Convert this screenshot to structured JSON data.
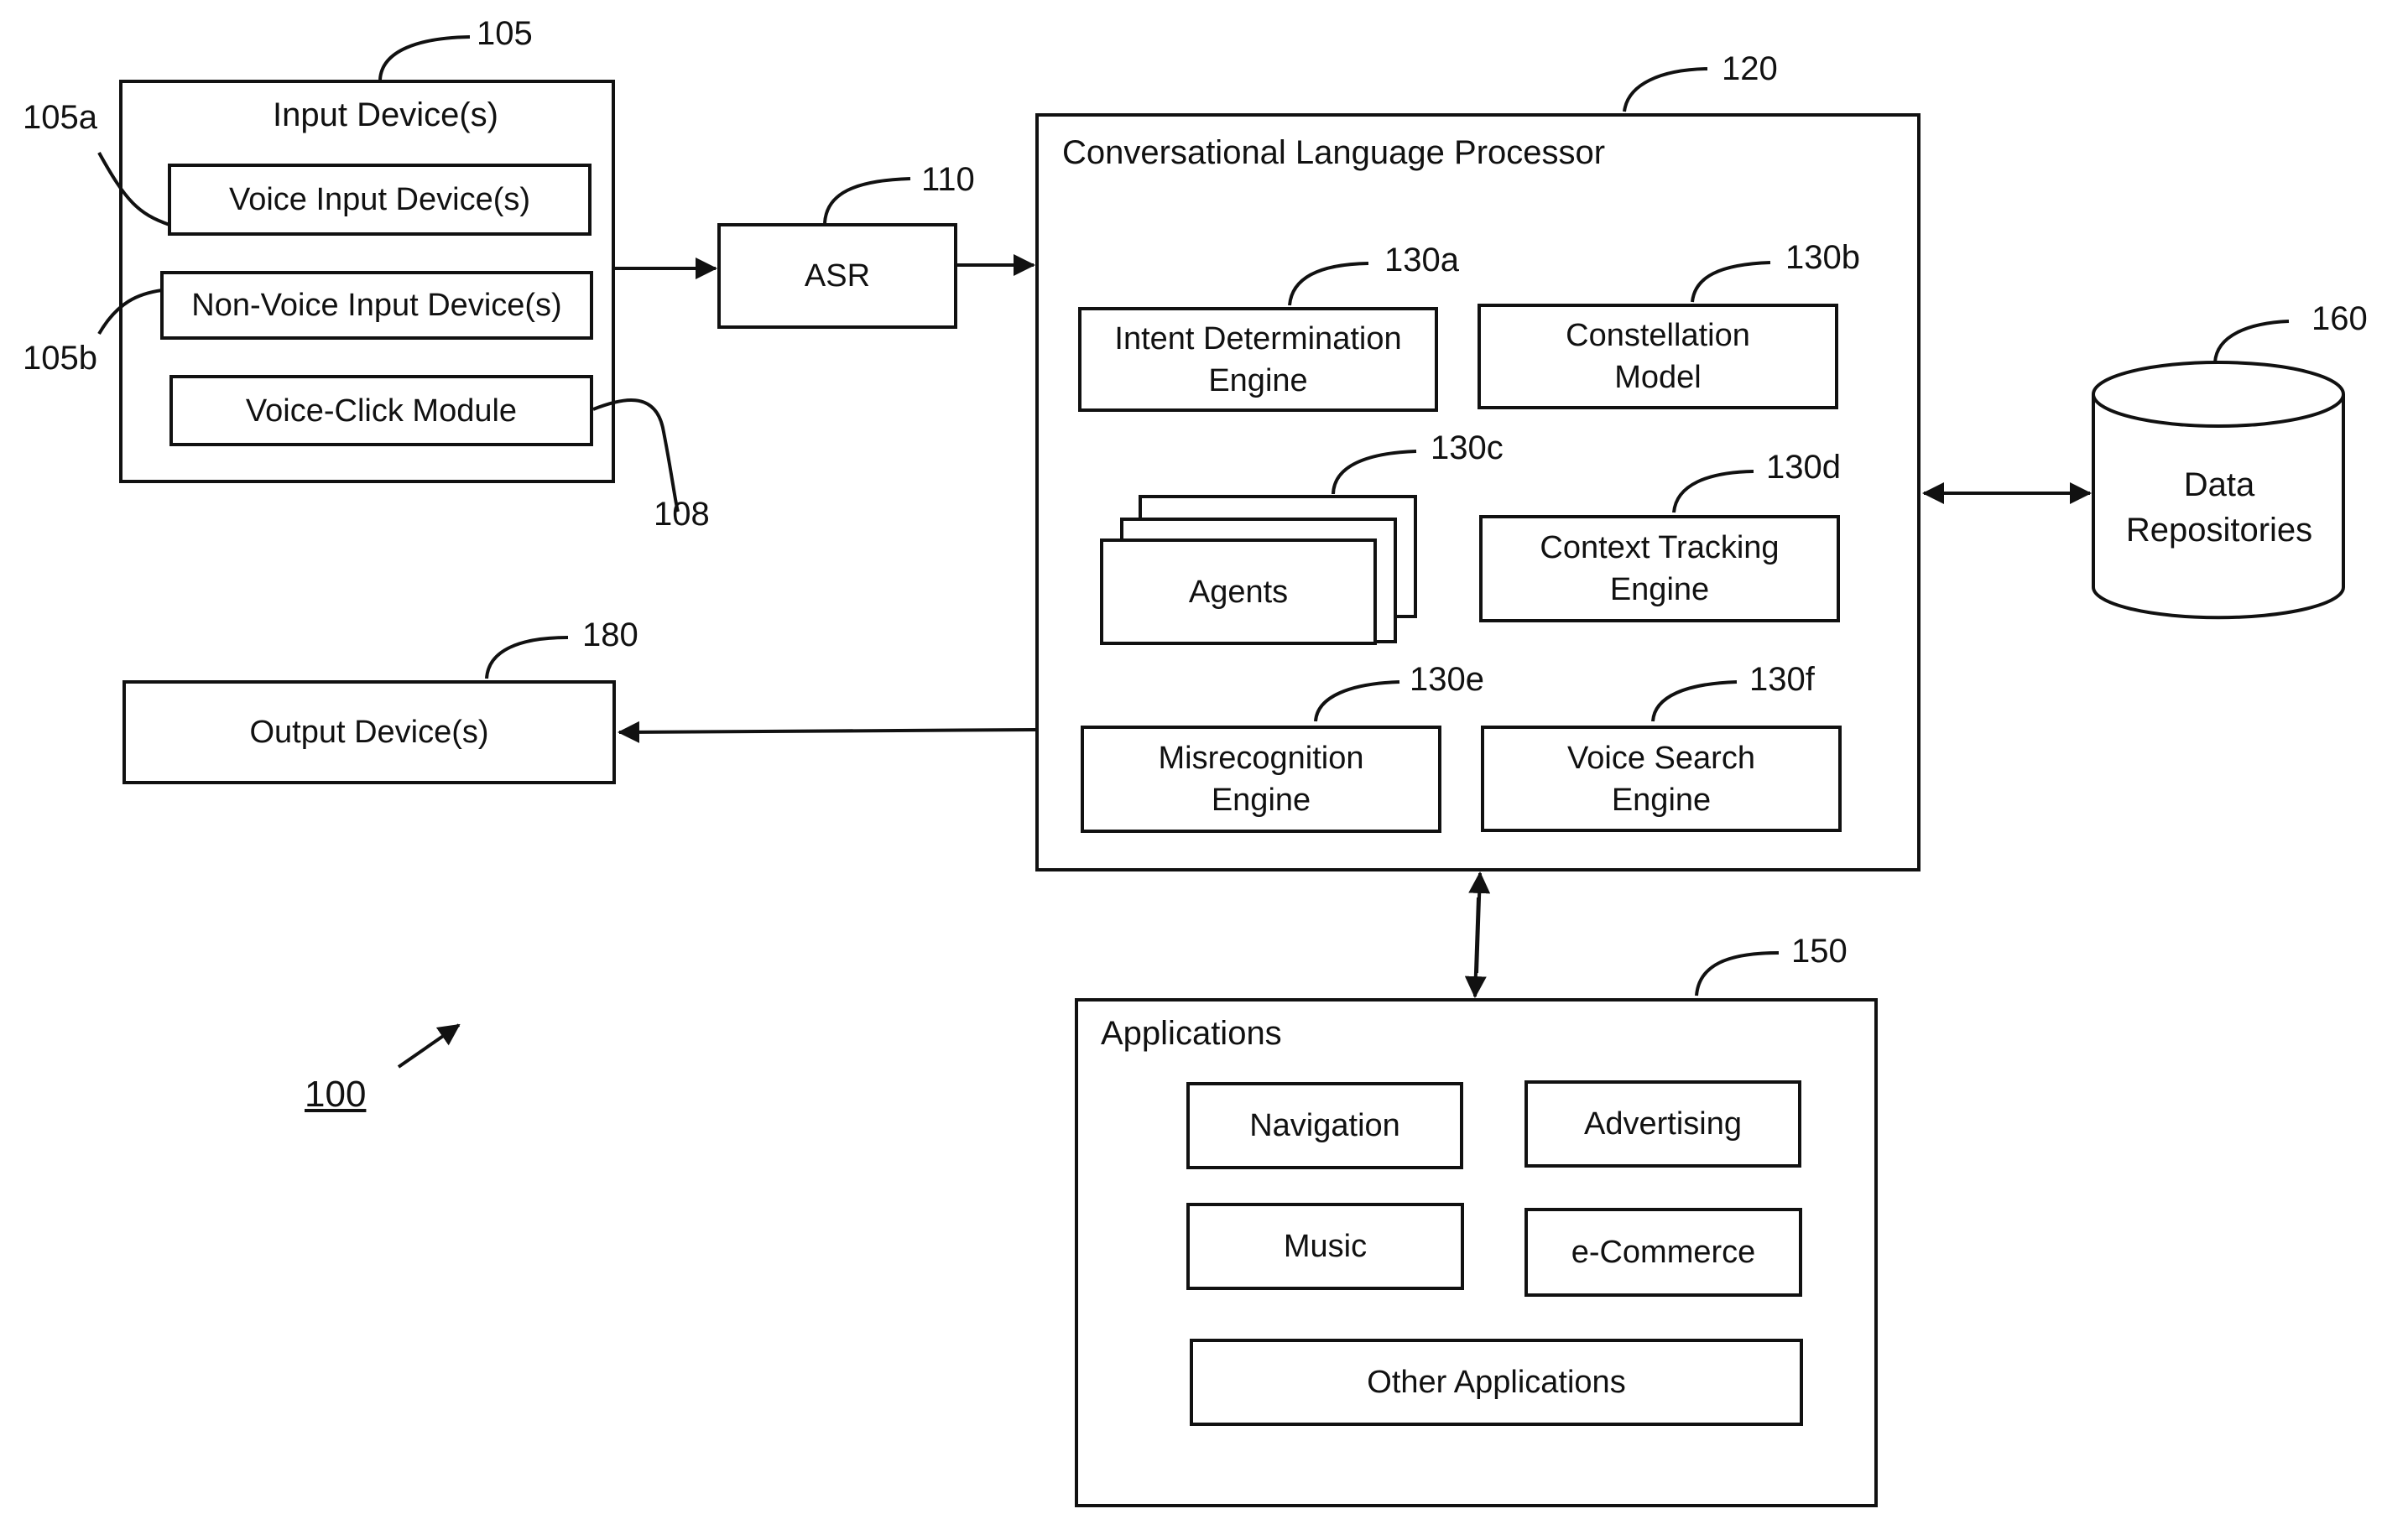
{
  "figure": {
    "number": "100",
    "input_devices": {
      "ref": "105",
      "title": "Input Device(s)",
      "voice_input": {
        "ref": "105a",
        "label": "Voice Input Device(s)"
      },
      "non_voice_input": {
        "ref": "105b",
        "label": "Non-Voice Input Device(s)"
      },
      "voice_click": {
        "ref": "108",
        "label": "Voice-Click Module"
      }
    },
    "asr": {
      "ref": "110",
      "label": "ASR"
    },
    "clp": {
      "ref": "120",
      "title": "Conversational Language Processor",
      "intent": {
        "ref": "130a",
        "label": "Intent Determination\nEngine"
      },
      "constellation": {
        "ref": "130b",
        "label": "Constellation\nModel"
      },
      "agents": {
        "ref": "130c",
        "label": "Agents"
      },
      "context": {
        "ref": "130d",
        "label": "Context Tracking\nEngine"
      },
      "misrecognition": {
        "ref": "130e",
        "label": "Misrecognition\nEngine"
      },
      "voice_search": {
        "ref": "130f",
        "label": "Voice Search\nEngine"
      }
    },
    "data_repositories": {
      "ref": "160",
      "label": "Data\nRepositories"
    },
    "output_devices": {
      "ref": "180",
      "label": "Output Device(s)"
    },
    "applications": {
      "ref": "150",
      "title": "Applications",
      "navigation": "Navigation",
      "advertising": "Advertising",
      "music": "Music",
      "ecommerce": "e-Commerce",
      "other": "Other Applications"
    }
  }
}
